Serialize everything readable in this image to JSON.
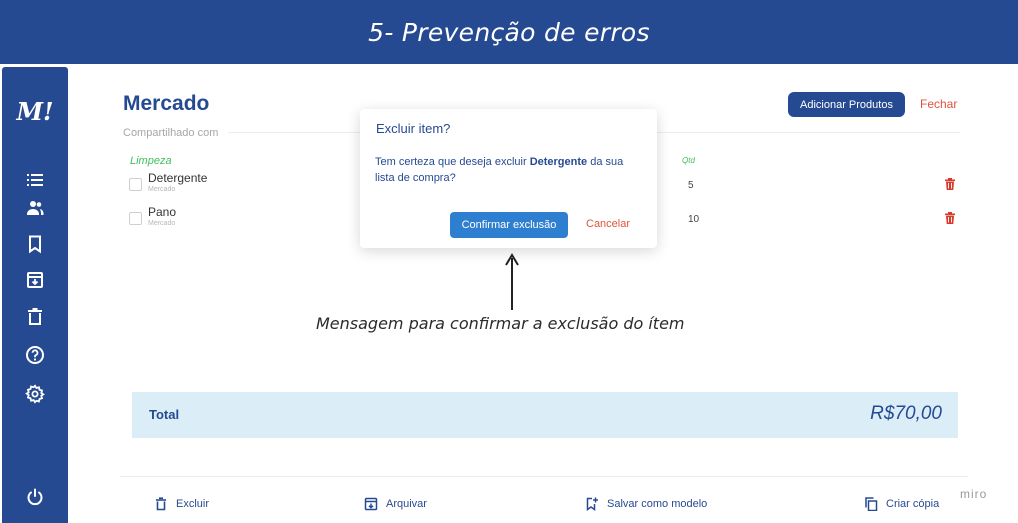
{
  "banner": {
    "title": "5- Prevenção de erros"
  },
  "sidebar": {
    "logo": "M!",
    "icons": [
      "list-icon",
      "users-icon",
      "bookmark-icon",
      "archive-icon",
      "trash-icon",
      "help-icon",
      "settings-icon",
      "power-icon"
    ]
  },
  "list": {
    "title": "Mercado",
    "shared_with": "Compartilhado com",
    "add_button": "Adicionar Produtos",
    "close_button": "Fechar",
    "category": "Limpeza",
    "qty_header": "Qtd",
    "items": [
      {
        "name": "Detergente",
        "sub": "Mercado",
        "qty": "5"
      },
      {
        "name": "Pano",
        "sub": "Mercado",
        "qty": "10"
      }
    ]
  },
  "dialog": {
    "title": "Excluir item?",
    "text_before": "Tem certeza que deseja excluir ",
    "text_bold": "Detergente",
    "text_after": " da sua lista de compra?",
    "confirm": "Confirmar exclusão",
    "cancel": "Cancelar"
  },
  "annotation": "Mensagem para confirmar a exclusão do ítem",
  "total": {
    "label": "Total",
    "value": "R$70,00"
  },
  "footer": {
    "delete": "Excluir",
    "archive": "Arquivar",
    "save_template": "Salvar como modelo",
    "copy": "Criar cópia"
  },
  "watermark": "miro",
  "colors": {
    "primary": "#264a92",
    "accent_red": "#e0543c",
    "category_green": "#3fbf5a",
    "confirm_blue": "#2f7fd1",
    "total_bg": "#dbeef8"
  }
}
